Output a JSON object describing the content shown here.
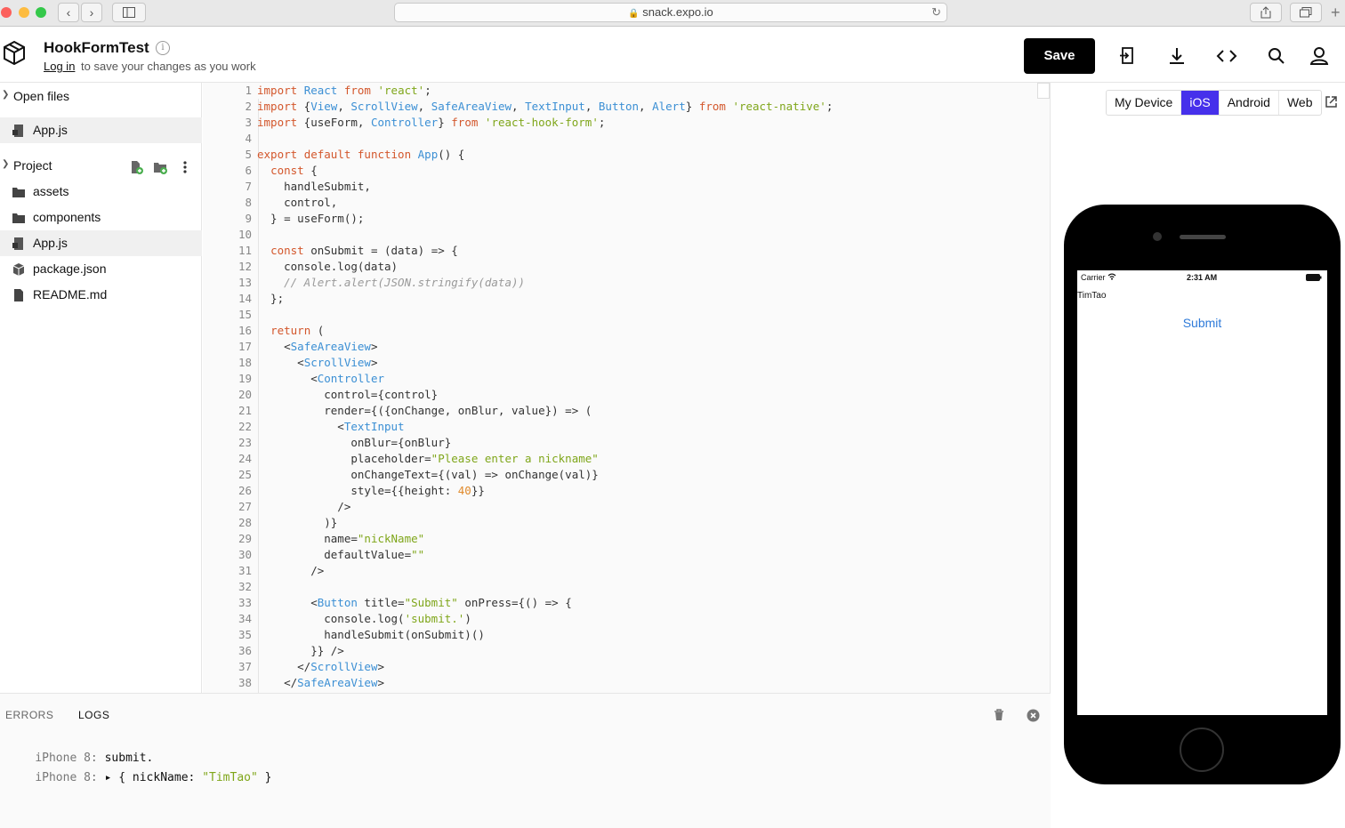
{
  "browser": {
    "url": "snack.expo.io"
  },
  "header": {
    "project_name": "HookFormTest",
    "login_label": "Log in",
    "subtitle_rest": "to save your changes as you work",
    "save_label": "Save"
  },
  "sidebar": {
    "open_files_label": "Open files",
    "open_files": [
      {
        "name": "App.js",
        "icon": "js-file-icon"
      }
    ],
    "project_label": "Project",
    "project_items": [
      {
        "name": "assets",
        "icon": "folder-icon"
      },
      {
        "name": "components",
        "icon": "folder-icon"
      },
      {
        "name": "App.js",
        "icon": "js-file-icon"
      },
      {
        "name": "package.json",
        "icon": "package-icon"
      },
      {
        "name": "README.md",
        "icon": "file-icon"
      }
    ]
  },
  "editor": {
    "line_count": 38,
    "lines": [
      "import React from 'react';",
      "import {View, ScrollView, SafeAreaView, TextInput, Button, Alert} from 'react-native';",
      "import {useForm, Controller} from 'react-hook-form';",
      "",
      "export default function App() {",
      "  const {",
      "    handleSubmit,",
      "    control,",
      "  } = useForm();",
      "",
      "  const onSubmit = (data) => {",
      "    console.log(data)",
      "    // Alert.alert(JSON.stringify(data))",
      "  };",
      "",
      "  return (",
      "    <SafeAreaView>",
      "      <ScrollView>",
      "        <Controller",
      "          control={control}",
      "          render={({onChange, onBlur, value}) => (",
      "            <TextInput",
      "              onBlur={onBlur}",
      "              placeholder=\"Please enter a nickname\"",
      "              onChangeText={(val) => onChange(val)}",
      "              style={{height: 40}}",
      "            />",
      "          )}",
      "          name=\"nickName\"",
      "          defaultValue=\"\"",
      "        />",
      "",
      "        <Button title=\"Submit\" onPress={() => {",
      "          console.log('submit.')",
      "          handleSubmit(onSubmit)()",
      "        }} />",
      "      </ScrollView>",
      "    </SafeAreaView>"
    ]
  },
  "console": {
    "tabs": [
      "ERRORS",
      "LOGS"
    ],
    "active_tab": "LOGS",
    "logs": [
      {
        "source": "iPhone 8:",
        "message": "submit."
      },
      {
        "source": "iPhone 8:",
        "prefix": "▸ { ",
        "key": "nickName:",
        "value": "\"TimTao\"",
        "suffix": " }"
      }
    ]
  },
  "preview": {
    "platform_tabs": [
      "My Device",
      "iOS",
      "Android",
      "Web"
    ],
    "selected_platform": "iOS",
    "device": {
      "carrier": "Carrier",
      "time": "2:31 AM",
      "input_value": "TimTao",
      "button_label": "Submit"
    }
  },
  "colors": {
    "accent": "#4630eb",
    "keyword": "#d3572c",
    "type": "#3b8fd4",
    "string": "#7fa61a",
    "number": "#e08a2c",
    "comment": "#9a9a9a",
    "ios_link": "#2f7bd9"
  }
}
